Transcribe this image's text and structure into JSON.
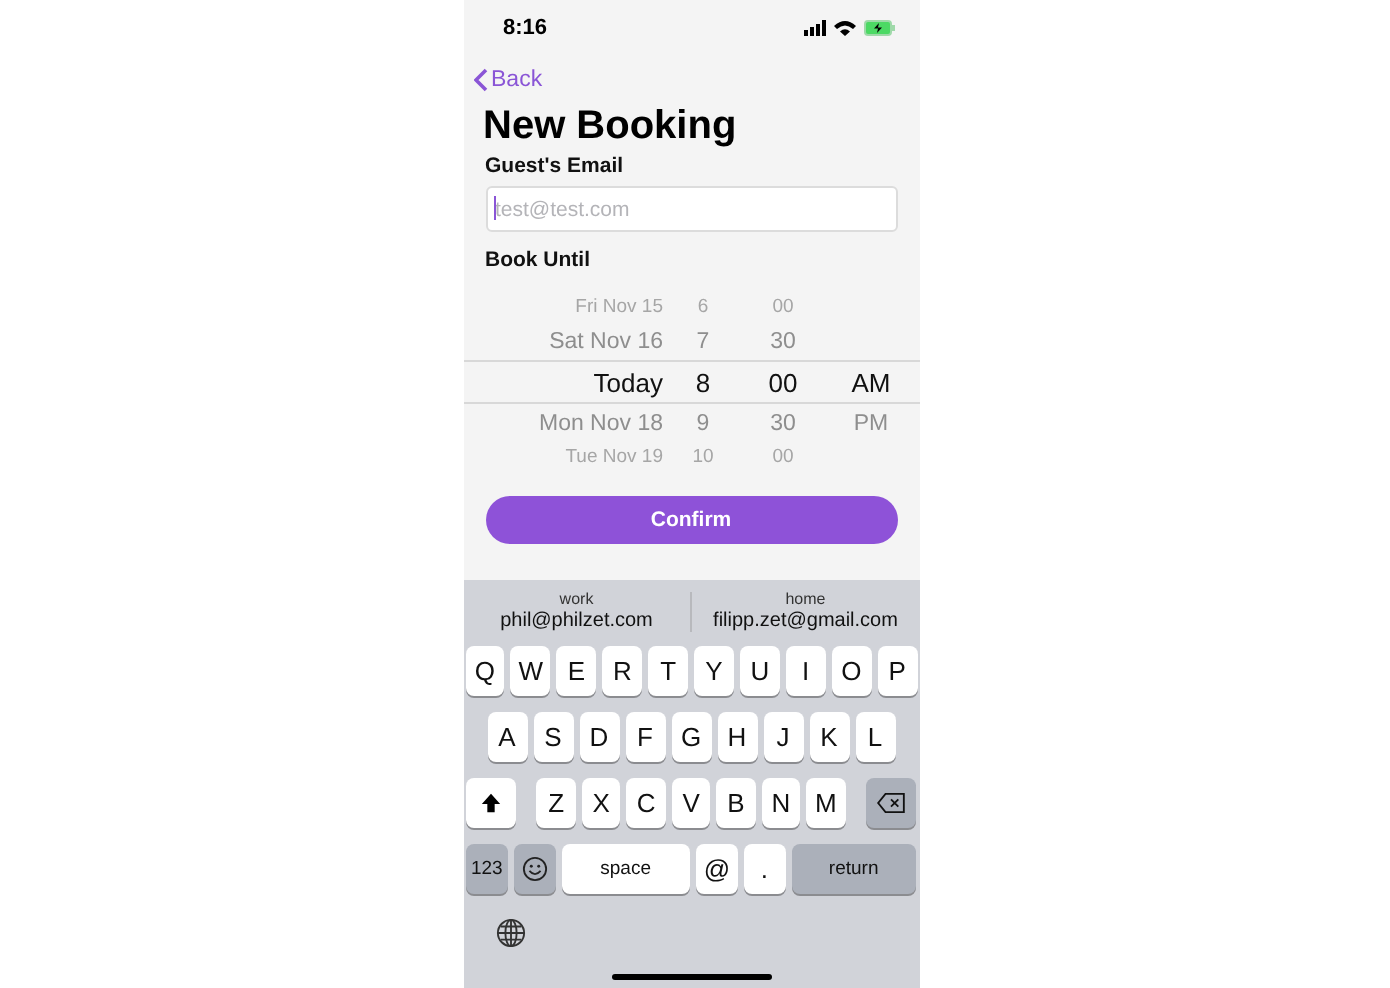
{
  "status_bar": {
    "time": "8:16"
  },
  "nav": {
    "back": "Back"
  },
  "title": "New Booking",
  "email": {
    "label": "Guest's Email",
    "placeholder": "test@test.com"
  },
  "book_until": {
    "label": "Book Until"
  },
  "picker": {
    "rows": [
      {
        "date": "Fri Nov 15",
        "hour": "6",
        "minute": "00",
        "period": "",
        "selected": false
      },
      {
        "date": "Sat Nov 16",
        "hour": "7",
        "minute": "30",
        "period": "",
        "selected": false
      },
      {
        "date": "Today",
        "hour": "8",
        "minute": "00",
        "period": "AM",
        "selected": true
      },
      {
        "date": "Mon Nov 18",
        "hour": "9",
        "minute": "30",
        "period": "PM",
        "selected": false
      },
      {
        "date": "Tue Nov 19",
        "hour": "10",
        "minute": "00",
        "period": "",
        "selected": false
      }
    ]
  },
  "confirm": "Confirm",
  "keyboard": {
    "suggestions": [
      {
        "label": "work",
        "value": "phil@philzet.com"
      },
      {
        "label": "home",
        "value": "filipp.zet@gmail.com"
      }
    ],
    "rows": [
      {
        "keys": [
          {
            "kind": "letter",
            "text": "Q"
          },
          {
            "kind": "letter",
            "text": "W"
          },
          {
            "kind": "letter",
            "text": "E"
          },
          {
            "kind": "letter",
            "text": "R"
          },
          {
            "kind": "letter",
            "text": "T"
          },
          {
            "kind": "letter",
            "text": "Y"
          },
          {
            "kind": "letter",
            "text": "U"
          },
          {
            "kind": "letter",
            "text": "I"
          },
          {
            "kind": "letter",
            "text": "O"
          },
          {
            "kind": "letter",
            "text": "P"
          }
        ]
      },
      {
        "keys": [
          {
            "kind": "letter",
            "text": "A"
          },
          {
            "kind": "letter",
            "text": "S"
          },
          {
            "kind": "letter",
            "text": "D"
          },
          {
            "kind": "letter",
            "text": "F"
          },
          {
            "kind": "letter",
            "text": "G"
          },
          {
            "kind": "letter",
            "text": "H"
          },
          {
            "kind": "letter",
            "text": "J"
          },
          {
            "kind": "letter",
            "text": "K"
          },
          {
            "kind": "letter",
            "text": "L"
          }
        ]
      },
      {
        "keys": [
          {
            "kind": "shift"
          },
          {
            "kind": "letter",
            "text": "Z"
          },
          {
            "kind": "letter",
            "text": "X"
          },
          {
            "kind": "letter",
            "text": "C"
          },
          {
            "kind": "letter",
            "text": "V"
          },
          {
            "kind": "letter",
            "text": "B"
          },
          {
            "kind": "letter",
            "text": "N"
          },
          {
            "kind": "letter",
            "text": "M"
          },
          {
            "kind": "delete"
          }
        ]
      },
      {
        "keys": [
          {
            "kind": "numbers",
            "text": "123"
          },
          {
            "kind": "emoji"
          },
          {
            "kind": "space",
            "text": "space"
          },
          {
            "kind": "letter",
            "text": "@"
          },
          {
            "kind": "letter",
            "text": "."
          },
          {
            "kind": "return",
            "text": "return"
          }
        ]
      }
    ]
  }
}
